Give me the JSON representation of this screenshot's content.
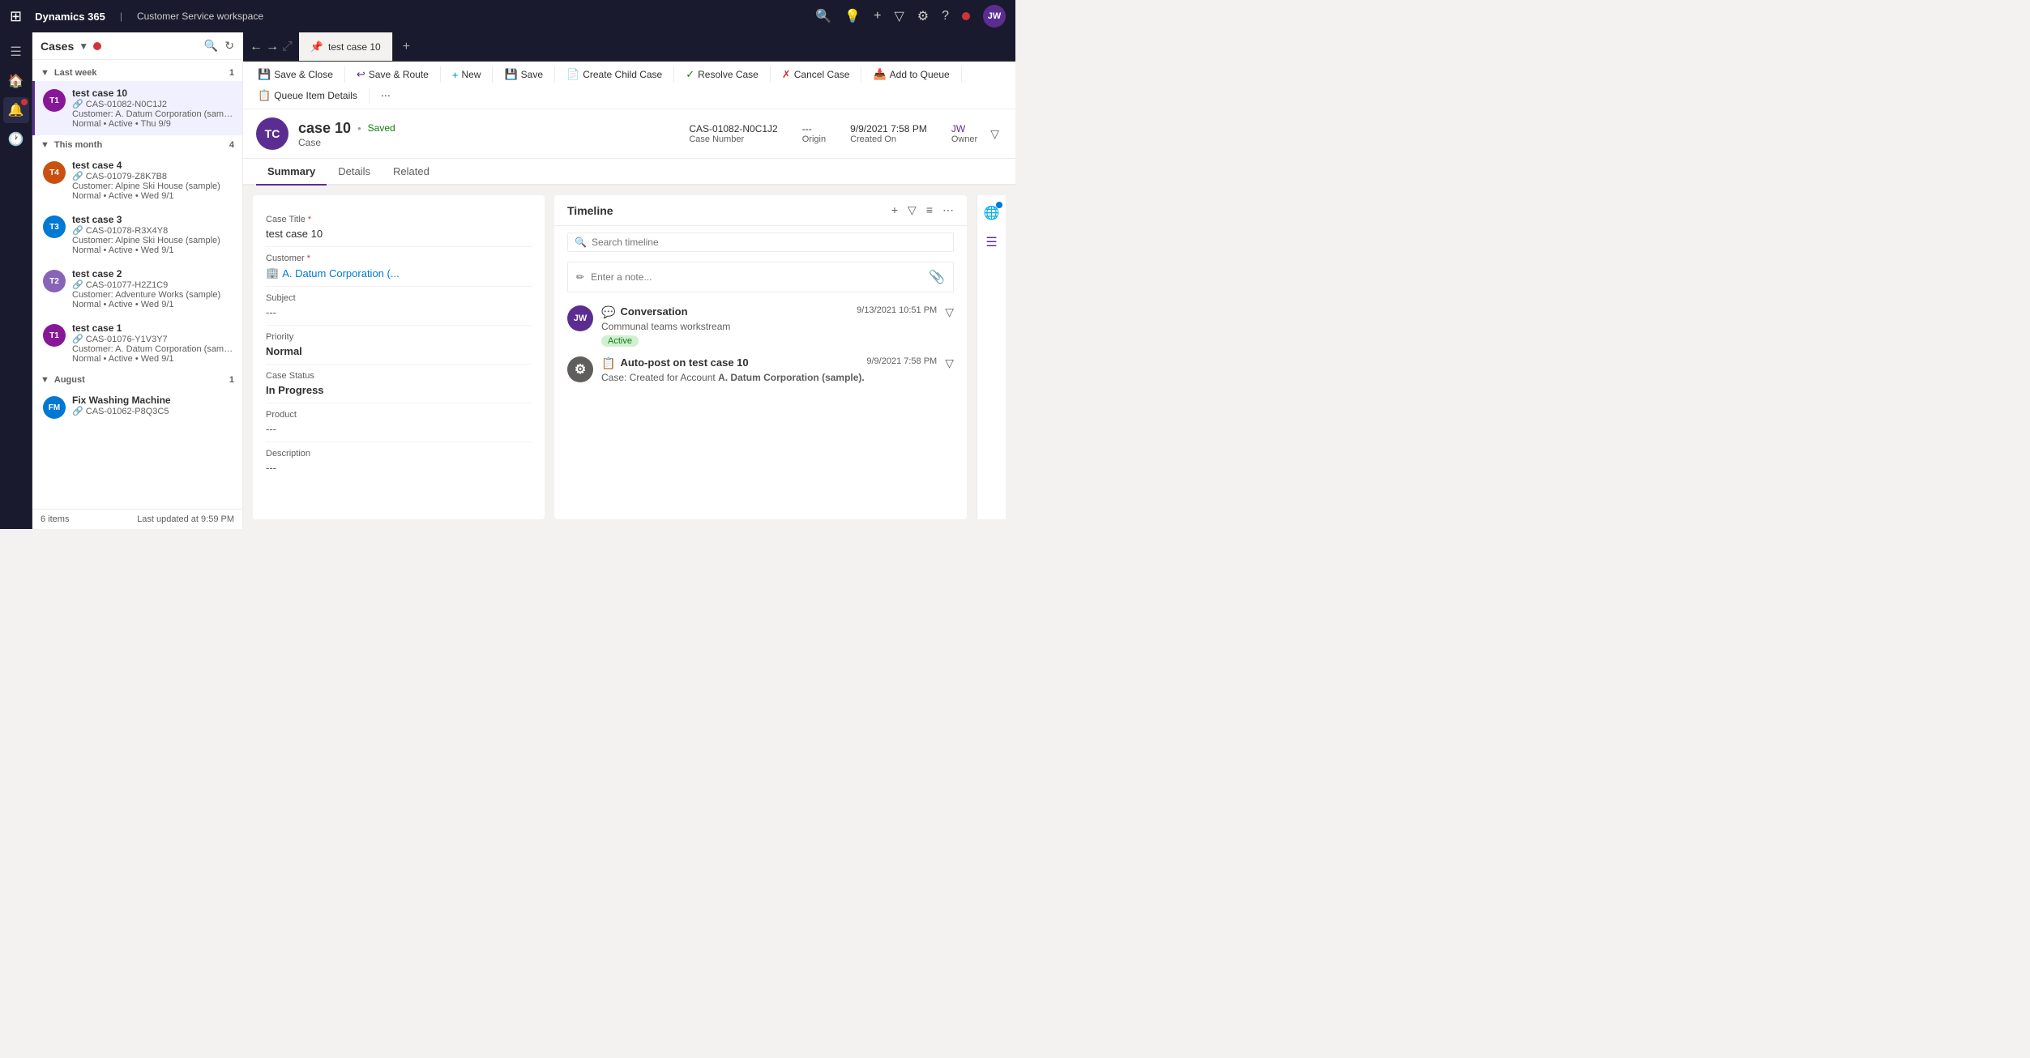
{
  "app": {
    "brand": "Dynamics 365",
    "workspace": "Customer Service workspace",
    "user_initials": "JW"
  },
  "topnav": {
    "icons": [
      "⊞",
      "🔍",
      "💡",
      "+",
      "▽",
      "⚙",
      "?"
    ]
  },
  "sidebar": {
    "icons": [
      "☰",
      "🏠",
      "🔔",
      "📋"
    ]
  },
  "cases_panel": {
    "title": "Cases",
    "sections": [
      {
        "label": "Last week",
        "count": "1",
        "expanded": true,
        "items": [
          {
            "id": "case-10",
            "name": "test case 10",
            "case_number": "CAS-01082-N0C1J2",
            "customer": "A. Datum Corporation (sampl...",
            "status": "Normal • Active • Thu 9/9",
            "avatar_initials": "T1",
            "avatar_color": "#881798",
            "active": true
          }
        ]
      },
      {
        "label": "This month",
        "count": "4",
        "expanded": true,
        "items": [
          {
            "id": "case-4",
            "name": "test case 4",
            "case_number": "CAS-01079-Z8K7B8",
            "customer": "Alpine Ski House (sample)",
            "status": "Normal • Active • Wed 9/1",
            "avatar_initials": "T4",
            "avatar_color": "#ca5010",
            "active": false
          },
          {
            "id": "case-3",
            "name": "test case 3",
            "case_number": "CAS-01078-R3X4Y8",
            "customer": "Alpine Ski House (sample)",
            "status": "Normal • Active • Wed 9/1",
            "avatar_initials": "T3",
            "avatar_color": "#0078d4",
            "active": false
          },
          {
            "id": "case-2",
            "name": "test case 2",
            "case_number": "CAS-01077-H2Z1C9",
            "customer": "Adventure Works (sample)",
            "status": "Normal • Active • Wed 9/1",
            "avatar_initials": "T2",
            "avatar_color": "#8764b8",
            "active": false
          },
          {
            "id": "case-1",
            "name": "test case 1",
            "case_number": "CAS-01076-Y1V3Y7",
            "customer": "A. Datum Corporation (sampl...",
            "status": "Normal • Active • Wed 9/1",
            "avatar_initials": "T1",
            "avatar_color": "#881798",
            "active": false
          }
        ]
      },
      {
        "label": "August",
        "count": "1",
        "expanded": true,
        "items": [
          {
            "id": "fix-washing",
            "name": "Fix Washing Machine",
            "case_number": "CAS-01062-P8Q3C5",
            "customer": "",
            "status": "",
            "avatar_initials": "FM",
            "avatar_color": "#0078d4",
            "active": false
          }
        ]
      }
    ],
    "footer_count": "6 items",
    "footer_updated": "Last updated at 9:59 PM"
  },
  "toolbar": {
    "save_close": "Save & Close",
    "save_route": "Save & Route",
    "new": "New",
    "save": "Save",
    "create_child": "Create Child Case",
    "resolve_case": "Resolve Case",
    "cancel_case": "Cancel Case",
    "add_to_queue": "Add to Queue",
    "queue_item_details": "Queue Item Details"
  },
  "record": {
    "tab_label": "test case 10",
    "avatar_initials": "TC",
    "name": "case 10",
    "saved_status": "Saved",
    "type": "Case",
    "case_number": "CAS-01082-N0C1J2",
    "case_number_label": "Case Number",
    "origin": "---",
    "origin_label": "Origin",
    "created_on": "9/9/2021 7:58 PM",
    "created_on_label": "Created On",
    "owner": "JW",
    "owner_label": "Owner"
  },
  "record_tabs": [
    "Summary",
    "Details",
    "Related"
  ],
  "form": {
    "fields": [
      {
        "label": "Case Title",
        "required": true,
        "value": "test case 10",
        "type": "text"
      },
      {
        "label": "Customer",
        "required": true,
        "value": "A. Datum Corporation (...",
        "type": "link"
      },
      {
        "label": "Subject",
        "required": false,
        "value": "---",
        "type": "dash"
      },
      {
        "label": "Priority",
        "required": false,
        "value": "Normal",
        "type": "bold"
      },
      {
        "label": "Case Status",
        "required": false,
        "value": "In Progress",
        "type": "bold"
      },
      {
        "label": "Product",
        "required": false,
        "value": "---",
        "type": "dash"
      },
      {
        "label": "Description",
        "required": false,
        "value": "---",
        "type": "dash"
      }
    ]
  },
  "timeline": {
    "title": "Timeline",
    "search_placeholder": "Search timeline",
    "note_placeholder": "Enter a note...",
    "items": [
      {
        "avatar_initials": "JW",
        "avatar_color": "#5c2d91",
        "icon": "💬",
        "title": "Conversation",
        "subtitle": "Communal teams workstream",
        "badge": "Active",
        "date": "9/13/2021 10:51 PM",
        "type": "conversation"
      },
      {
        "avatar_initials": "⚙",
        "avatar_color": "#605e5c",
        "icon": "📋",
        "title": "Auto-post on test case 10",
        "text": "Case: Created for Account A. Datum Corporation (sample).",
        "date": "9/9/2021 7:58 PM",
        "type": "auto-post"
      }
    ]
  }
}
